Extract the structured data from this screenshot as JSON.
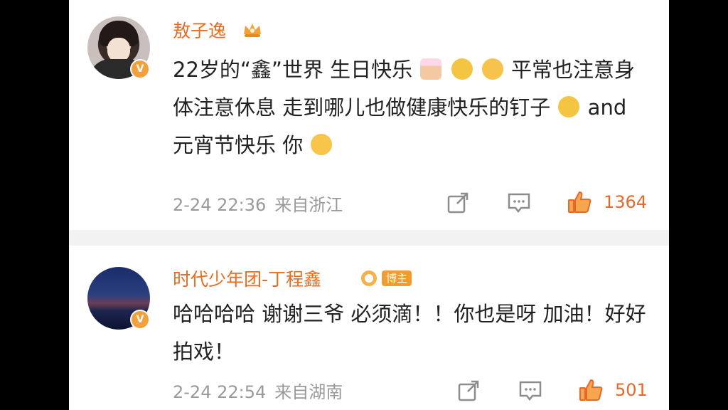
{
  "comments": [
    {
      "username": "敖子逸",
      "text_parts": [
        "22岁的“鑫”世界 生日快乐",
        " 平常也注意身体注意休息 走到哪儿也做健康快乐的钉子",
        " and 元宵节快乐 你"
      ],
      "time": "2-24 22:36",
      "location": "来自浙江",
      "likes": "1364",
      "verified": "V"
    },
    {
      "username": "时代少年团-丁程鑫",
      "badge": "博主",
      "text": "哈哈哈哈 谢谢三爷 必须滴！！你也是呀 加油！好好拍戏！",
      "time": "2-24 22:54",
      "location": "来自湖南",
      "likes": "501",
      "verified": "V"
    }
  ],
  "icons": {
    "share": "share-icon",
    "comment": "comment-icon",
    "like": "thumbs-up-icon",
    "crown": "crown-icon"
  },
  "colors": {
    "username": "#e86b1f",
    "like": "#e8682b",
    "meta": "#9a9a9a",
    "badge": "#f39b2f"
  }
}
